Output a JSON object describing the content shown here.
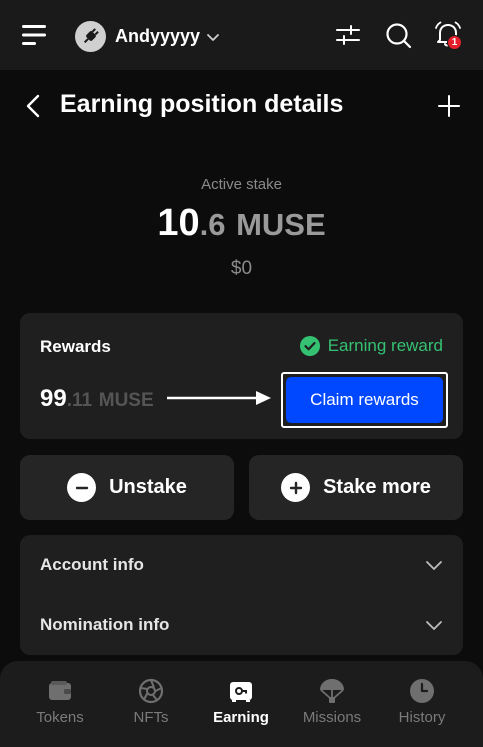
{
  "header": {
    "account_name": "Andyyyyy",
    "notification_count": "1",
    "icons": [
      "menu-icon",
      "plug-icon",
      "chevron-down-icon",
      "sliders-icon",
      "search-icon",
      "bell-icon"
    ]
  },
  "page": {
    "title": "Earning position details",
    "icons": [
      "back-arrow-icon",
      "plus-icon"
    ]
  },
  "stake": {
    "label": "Active stake",
    "amount_int": "10",
    "amount_dec": ".6",
    "unit": "MUSE",
    "usd": "$0"
  },
  "rewards": {
    "title": "Rewards",
    "status": "Earning reward",
    "amount_int": "99",
    "amount_dec": ".11",
    "unit": "MUSE",
    "claim_label": "Claim rewards",
    "colors": {
      "status": "#35c172",
      "claim_button": "#0048ff"
    }
  },
  "actions": [
    {
      "label": "Unstake",
      "icon": "minus-circle-icon"
    },
    {
      "label": "Stake more",
      "icon": "plus-circle-icon"
    }
  ],
  "info": [
    {
      "label": "Account info"
    },
    {
      "label": "Nomination info"
    }
  ],
  "nav": [
    {
      "label": "Tokens",
      "icon": "wallet-icon",
      "active": false
    },
    {
      "label": "NFTs",
      "icon": "aperture-icon",
      "active": false
    },
    {
      "label": "Earning",
      "icon": "safe-icon",
      "active": true
    },
    {
      "label": "Missions",
      "icon": "parachute-icon",
      "active": false
    },
    {
      "label": "History",
      "icon": "clock-icon",
      "active": false
    }
  ]
}
